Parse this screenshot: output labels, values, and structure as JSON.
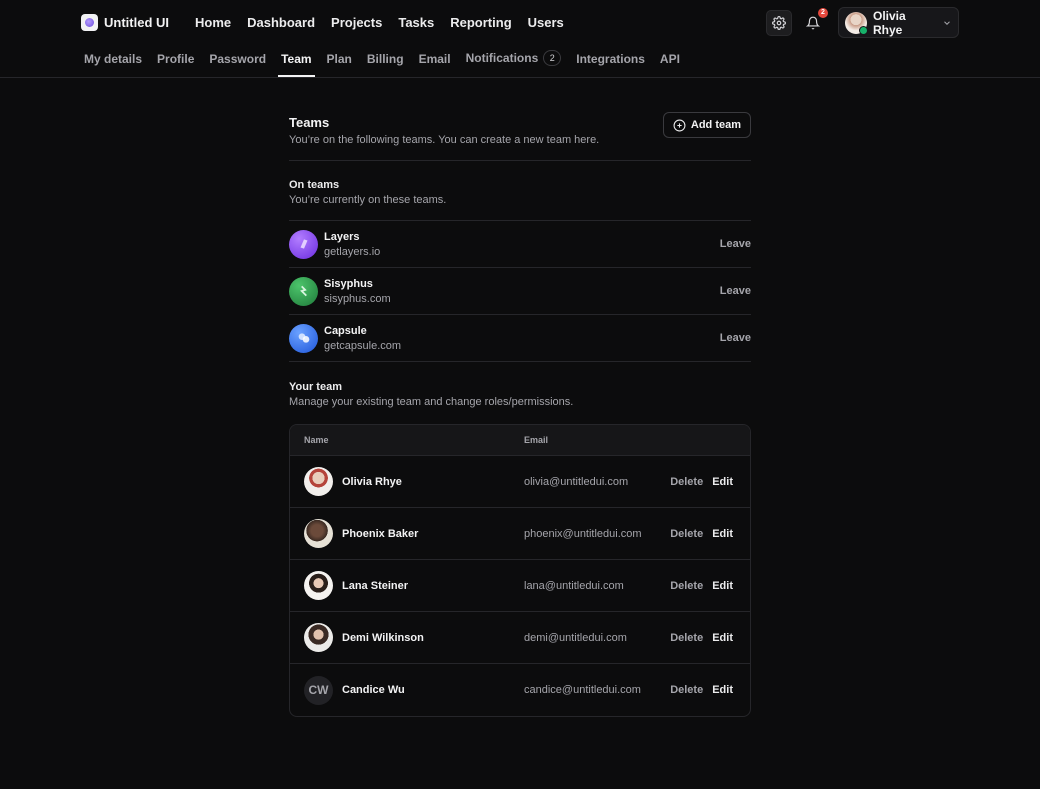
{
  "brand": {
    "name": "Untitled UI"
  },
  "topnav": [
    "Home",
    "Dashboard",
    "Projects",
    "Tasks",
    "Reporting",
    "Users"
  ],
  "header": {
    "notification_count": "2",
    "user_name": "Olivia Rhye",
    "icons": {
      "settings": "gear-icon",
      "notifications": "bell-icon",
      "menu": "chevron-down-icon"
    }
  },
  "subtabs": [
    {
      "label": "My details"
    },
    {
      "label": "Profile"
    },
    {
      "label": "Password"
    },
    {
      "label": "Team",
      "active": true
    },
    {
      "label": "Plan"
    },
    {
      "label": "Billing"
    },
    {
      "label": "Email"
    },
    {
      "label": "Notifications",
      "count": "2"
    },
    {
      "label": "Integrations"
    },
    {
      "label": "API"
    }
  ],
  "teams_section": {
    "title": "Teams",
    "subtitle": "You’re on the following teams. You can create a new team here.",
    "add_button": "Add team"
  },
  "on_teams": {
    "title": "On teams",
    "subtitle": "You’re currently on these teams.",
    "teams": [
      {
        "name": "Layers",
        "url": "getlayers.io",
        "action": "Leave",
        "color": "#7a3df0"
      },
      {
        "name": "Sisyphus",
        "url": "sisyphus.com",
        "action": "Leave",
        "color": "#2e9d4e"
      },
      {
        "name": "Capsule",
        "url": "getcapsule.com",
        "action": "Leave",
        "color": "#2e6df0"
      }
    ]
  },
  "your_team": {
    "title": "Your team",
    "subtitle": "Manage your existing team and change roles/permissions.",
    "columns": {
      "name": "Name",
      "email": "Email"
    },
    "members": [
      {
        "name": "Olivia Rhye",
        "email": "olivia@untitledui.com",
        "delete": "Delete",
        "edit": "Edit"
      },
      {
        "name": "Phoenix Baker",
        "email": "phoenix@untitledui.com",
        "delete": "Delete",
        "edit": "Edit"
      },
      {
        "name": "Lana Steiner",
        "email": "lana@untitledui.com",
        "delete": "Delete",
        "edit": "Edit"
      },
      {
        "name": "Demi Wilkinson",
        "email": "demi@untitledui.com",
        "delete": "Delete",
        "edit": "Edit"
      },
      {
        "name": "Candice Wu",
        "email": "candice@untitledui.com",
        "delete": "Delete",
        "edit": "Edit",
        "initials": "CW"
      }
    ]
  }
}
